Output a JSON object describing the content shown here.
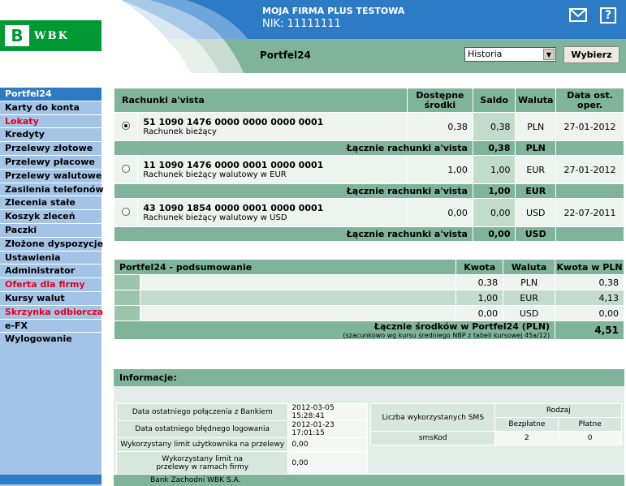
{
  "header": {
    "firm_name": "MOJA FIRMA PLUS TESTOWA",
    "nik": "NIK: 11111111",
    "logo_text": "WBK",
    "logo_mark": "B",
    "help_glyph": "?"
  },
  "titlebar": {
    "title": "Portfel24",
    "select_value": "Historia",
    "choose_label": "Wybierz"
  },
  "sidebar": {
    "items": [
      {
        "label": "Portfel24"
      },
      {
        "label": "Karty do konta"
      },
      {
        "label": "Lokaty"
      },
      {
        "label": "Kredyty"
      },
      {
        "label": "Przelewy złotowe"
      },
      {
        "label": "Przelewy płacowe"
      },
      {
        "label": "Przelewy walutowe"
      },
      {
        "label": "Zasilenia telefonów"
      },
      {
        "label": "Zlecenia stałe"
      },
      {
        "label": "Koszyk zleceń"
      },
      {
        "label": "Paczki"
      },
      {
        "label": "Złożone dyspozycje"
      },
      {
        "label": "Ustawienia"
      },
      {
        "label": "Administrator"
      },
      {
        "label": "Oferta dla firmy"
      },
      {
        "label": "Kursy walut"
      },
      {
        "label": "Skrzynka odbiorcza"
      },
      {
        "label": "e-FX"
      },
      {
        "label": "Wylogowanie"
      }
    ]
  },
  "accounts": {
    "headers": {
      "account": "Rachunki a'vista",
      "available": "Dostępne środki",
      "balance": "Saldo",
      "currency": "Waluta",
      "last_op": "Data ost. oper."
    },
    "rows": [
      {
        "number": "51 1090 1476 0000 0000 0000 0001",
        "desc": "Rachunek bieżący",
        "available": "0,38",
        "balance": "0,38",
        "currency": "PLN",
        "date": "27-01-2012",
        "sum_label": "Łącznie rachunki a'vista",
        "sum_value": "0,38",
        "sum_currency": "PLN"
      },
      {
        "number": "11 1090 1476 0000 0001 0000 0001",
        "desc": "Rachunek bieżący walutowy w EUR",
        "available": "1,00",
        "balance": "1,00",
        "currency": "EUR",
        "date": "27-01-2012",
        "sum_label": "Łącznie rachunki a'vista",
        "sum_value": "1,00",
        "sum_currency": "EUR"
      },
      {
        "number": "43 1090 1854 0000 0001 0000 0001",
        "desc": "Rachunek bieżący walutowy w USD",
        "available": "0,00",
        "balance": "0,00",
        "currency": "USD",
        "date": "22-07-2011",
        "sum_label": "Łącznie rachunki a'vista",
        "sum_value": "0,00",
        "sum_currency": "USD"
      }
    ]
  },
  "summary": {
    "headers": {
      "title": "Portfel24 - podsumowanie",
      "amount": "Kwota",
      "currency": "Waluta",
      "amount_pln": "Kwota w PLN"
    },
    "rows": [
      {
        "amount": "0,38",
        "currency": "PLN",
        "amount_pln": "0,38"
      },
      {
        "amount": "1,00",
        "currency": "EUR",
        "amount_pln": "4,13"
      },
      {
        "amount": "0,00",
        "currency": "USD",
        "amount_pln": "0,00"
      }
    ],
    "total_label": "Łącznie środków w Portfel24 (PLN)",
    "total_note": "(szacunkowo wg kursu średniego NBP z tabeli kursowej 45a/12)",
    "total_value": "4,51"
  },
  "info": {
    "title": "Informacje:",
    "last_login_label": "Data ostatniego połączenia z Bankiem",
    "last_login_value": "2012-03-05 15:28:41",
    "last_failed_label": "Data ostatniego błędnego logowania",
    "last_failed_value": "2012-01-23 17:01:15",
    "user_limit_label": "Wykorzystany limit użytkownika na przelewy",
    "user_limit_value": "0,00",
    "firm_limit_label": "Wykorzystany limit na przelewy w ramach firmy",
    "firm_limit_value": "0,00",
    "sms_label": "Liczba wykorzystanych SMS",
    "kind_label": "Rodzaj",
    "free_label": "Bezpłatne",
    "paid_label": "Płatne",
    "sms_type": "smsKod",
    "sms_free": "2",
    "sms_paid": "0"
  },
  "footer": {
    "text": "Bank Zachodni WBK S.A."
  },
  "colors": {
    "header_blue": "#2e7bc5",
    "green": "#7fb49a",
    "logo_green": "#009933",
    "sidebar": "#a3c4e6",
    "red_link": "#e8001c"
  }
}
